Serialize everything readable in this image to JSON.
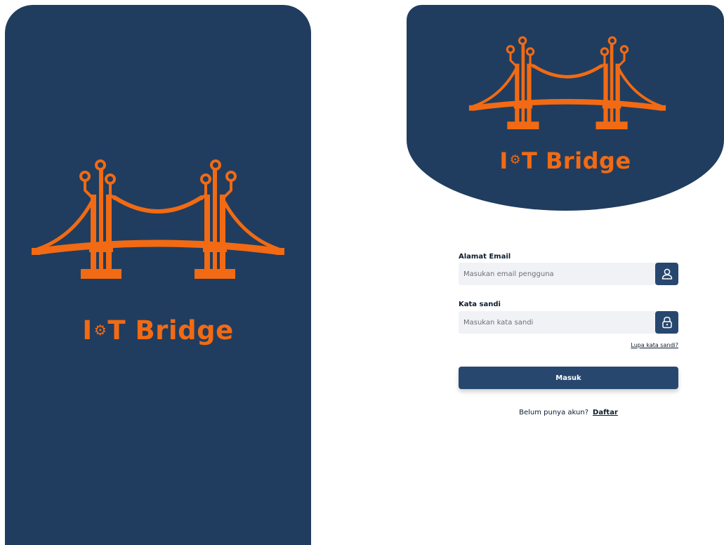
{
  "brand": {
    "name_prefix": "I",
    "gear_glyph": "⚙",
    "name_suffix": "T Bridge",
    "logo_icon": "suspension-bridge-icon",
    "colors": {
      "navy": "#203d5f",
      "orange": "#f26a13",
      "button": "#27476f"
    }
  },
  "login": {
    "email": {
      "label": "Alamat Email",
      "placeholder": "Masukan email pengguna",
      "value": "",
      "icon": "user-icon"
    },
    "password": {
      "label": "Kata sandi",
      "placeholder": "Masukan kata sandi",
      "value": "",
      "icon": "lock-icon"
    },
    "forgot_link": "Lupa kata sandi?",
    "submit_label": "Masuk",
    "signup_prompt": "Belum punya akun?",
    "signup_link": "Daftar"
  }
}
